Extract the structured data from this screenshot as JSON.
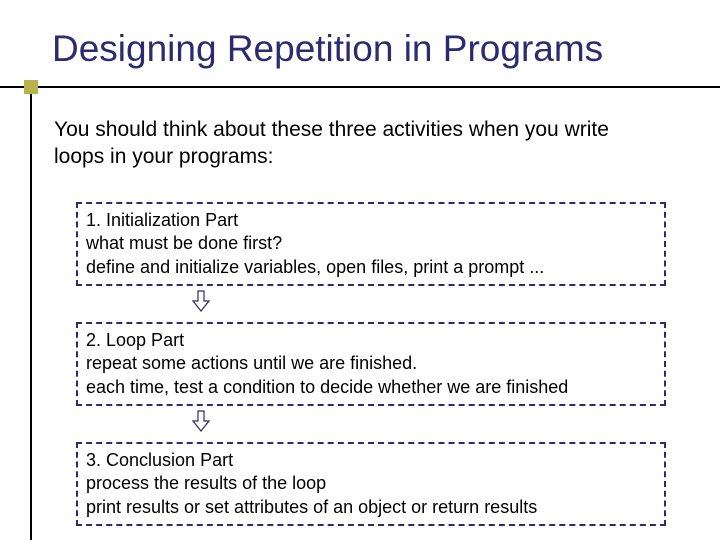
{
  "title": "Designing Repetition in Programs",
  "intro": "You should think about these three activities when you write loops in your programs:",
  "box1": {
    "line1": "1.  Initialization Part",
    "line2": "what must be done first?",
    "line3": "define and initialize variables, open files, print a prompt ..."
  },
  "box2": {
    "line1": "2.  Loop Part",
    "line2": "repeat some actions until we are finished.",
    "line3": "each time, test a condition to decide whether we are finished"
  },
  "box3": {
    "line1": "3.  Conclusion Part",
    "line2": "process the results of the loop",
    "line3": "print results or set attributes of an object or return results"
  }
}
